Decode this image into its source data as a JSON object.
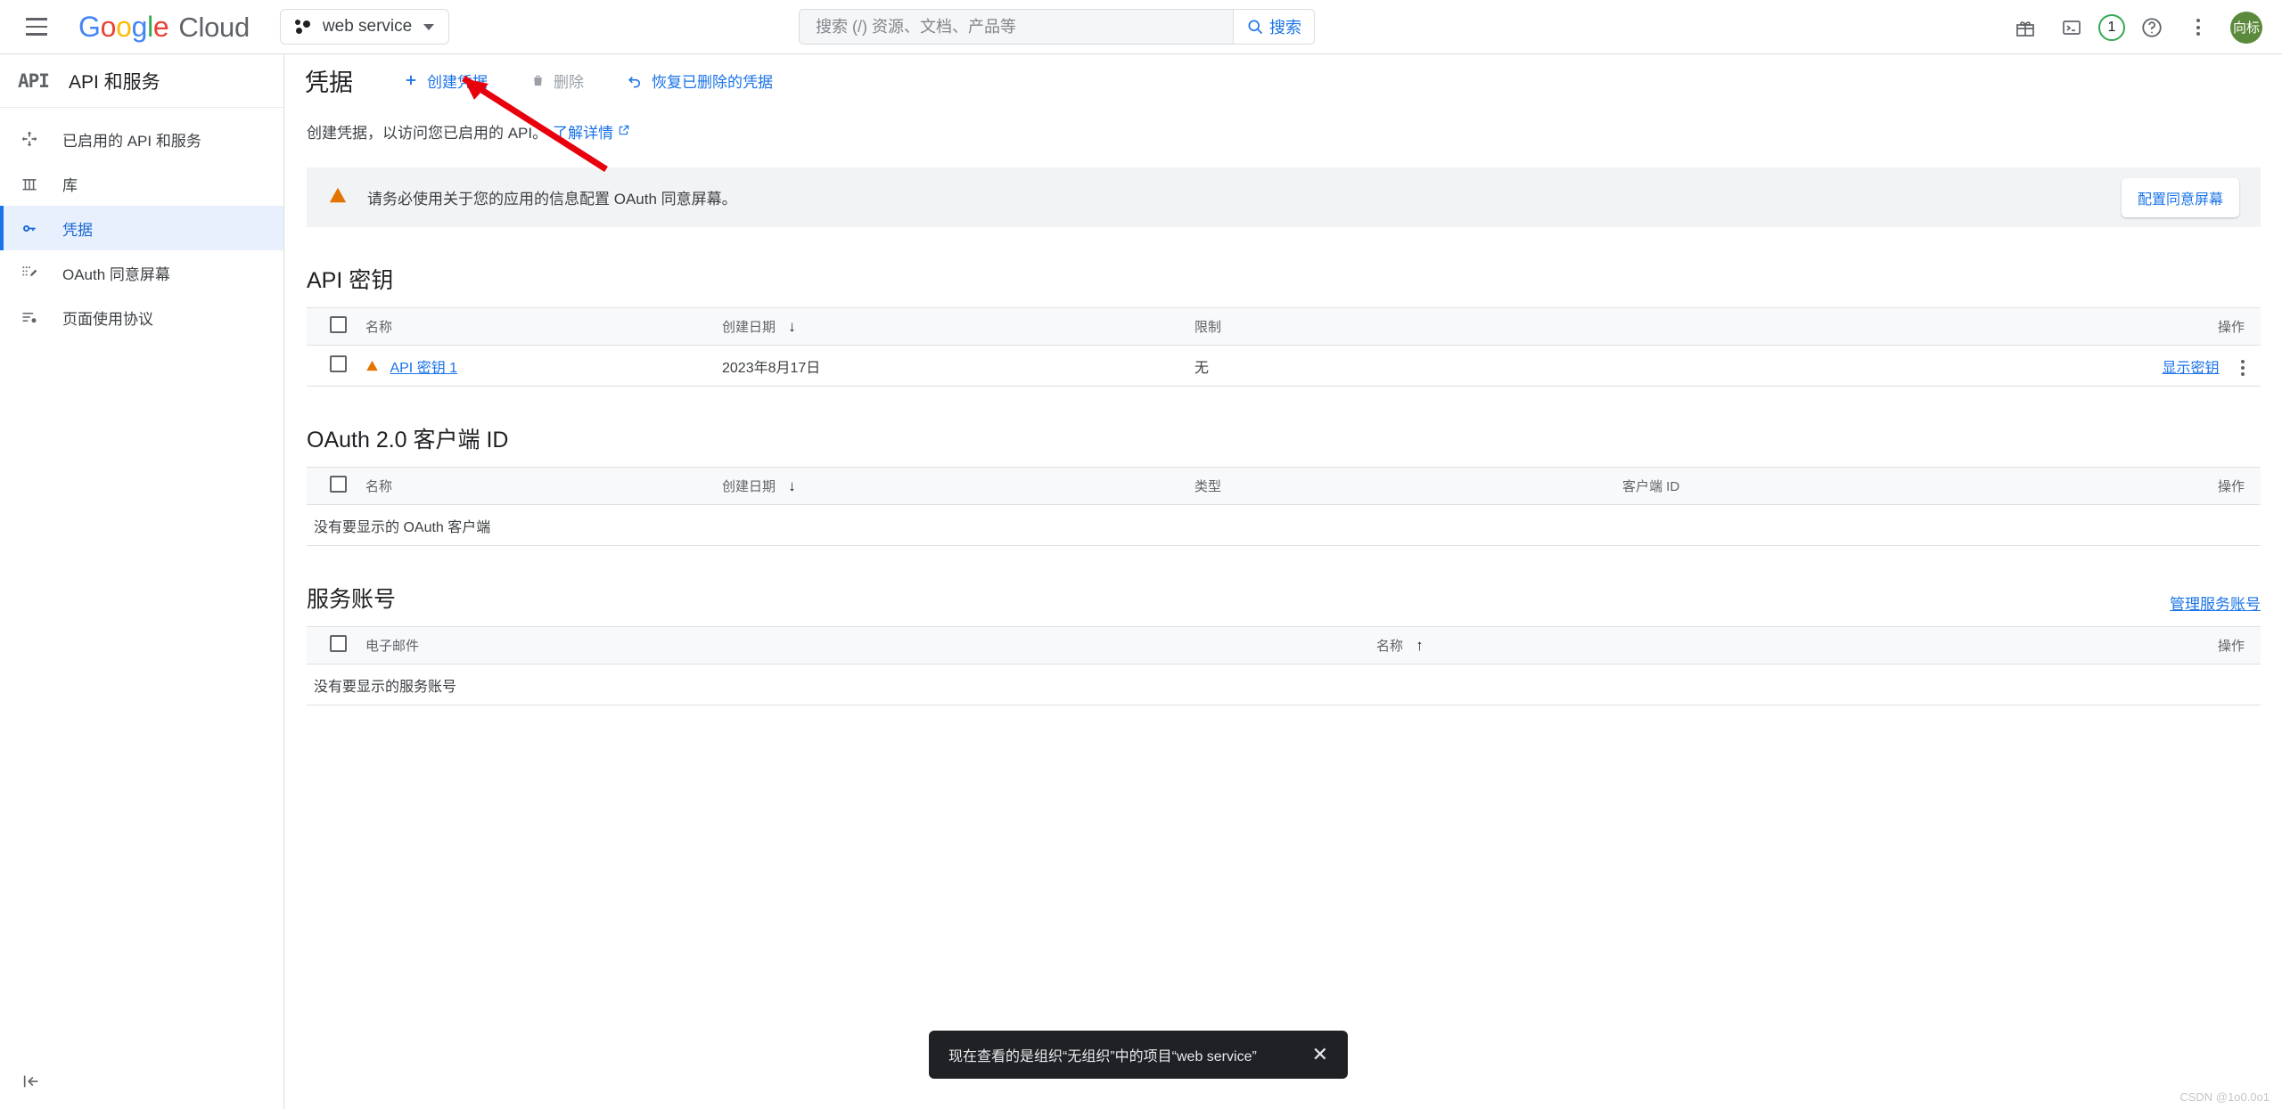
{
  "header": {
    "menu_icon": "hamburger-icon",
    "brand": {
      "g": "G",
      "o1": "o",
      "o2": "o",
      "g2": "g",
      "l": "l",
      "e": "e",
      "cloud": "Cloud"
    },
    "project_selector": {
      "label": "web service",
      "icon": "project-dots-icon"
    },
    "search": {
      "placeholder": "搜索 (/) 资源、文档、产品等",
      "value": "",
      "button_label": "搜索"
    },
    "icons": {
      "gift": "gift-icon",
      "cloud_shell": "cloud-shell-icon",
      "notifications_count": "1",
      "help": "help-icon",
      "more": "more-vert-icon"
    },
    "avatar_label": "向标"
  },
  "sidebar": {
    "logo_text": "API",
    "title": "API 和服务",
    "items": [
      {
        "label": "已启用的 API 和服务",
        "icon": "enabled-apis-icon",
        "active": false
      },
      {
        "label": "库",
        "icon": "library-icon",
        "active": false
      },
      {
        "label": "凭据",
        "icon": "key-icon",
        "active": true
      },
      {
        "label": "OAuth 同意屏幕",
        "icon": "oauth-consent-icon",
        "active": false
      },
      {
        "label": "页面使用协议",
        "icon": "page-usage-icon",
        "active": false
      }
    ],
    "collapse_icon": "collapse-panel-icon"
  },
  "main": {
    "page_title": "凭据",
    "actions": [
      {
        "label": "创建凭据",
        "icon": "plus-icon",
        "disabled": false
      },
      {
        "label": "删除",
        "icon": "trash-icon",
        "disabled": true
      },
      {
        "label": "恢复已删除的凭据",
        "icon": "undo-icon",
        "disabled": false
      }
    ],
    "description": "创建凭据，以访问您已启用的 API。",
    "description_link": "了解详情",
    "banner": {
      "icon": "warning-icon",
      "text": "请务必使用关于您的应用的信息配置 OAuth 同意屏幕。",
      "button_label": "配置同意屏幕"
    },
    "sections": [
      {
        "title": "API 密钥",
        "link": "",
        "columns": [
          "名称",
          "创建日期",
          "限制",
          "操作"
        ],
        "sort_column": "创建日期",
        "sort_direction": "down",
        "rows": [
          {
            "name": "API 密钥 1",
            "created": "2023年8月17日",
            "restriction": "无",
            "action": "显示密钥",
            "warning": true
          }
        ],
        "empty_text": ""
      },
      {
        "title": "OAuth 2.0 客户端 ID",
        "link": "",
        "columns": [
          "名称",
          "创建日期",
          "类型",
          "客户端 ID",
          "操作"
        ],
        "sort_column": "创建日期",
        "sort_direction": "down",
        "rows": [],
        "empty_text": "没有要显示的 OAuth 客户端"
      },
      {
        "title": "服务账号",
        "link": "管理服务账号",
        "columns": [
          "电子邮件",
          "名称",
          "操作"
        ],
        "sort_column": "名称",
        "sort_direction": "up",
        "rows": [],
        "empty_text": "没有要显示的服务账号"
      }
    ]
  },
  "toast": {
    "text": "现在查看的是组织“无组织”中的项目“web service”",
    "close_icon": "close-icon"
  },
  "watermark": "CSDN @1o0.0o1",
  "colors": {
    "accent": "#1a73e8",
    "warning": "#e37400",
    "active_bg": "#e8f0fe",
    "avatar_bg": "#5c8a3c",
    "notif_ring": "#34a853"
  }
}
